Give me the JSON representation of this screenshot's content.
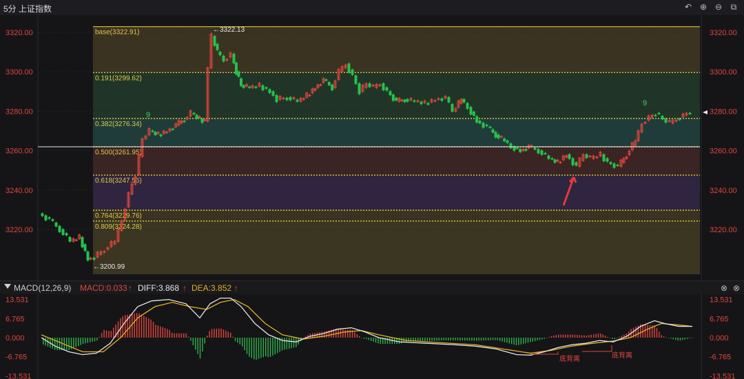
{
  "header": {
    "title": "5分 上证指数"
  },
  "toolbar": {
    "icons": [
      "undo-icon",
      "zoom-in-icon",
      "zoom-out-icon",
      "fullscreen-icon"
    ]
  },
  "price_axis": {
    "labels": [
      "3320.00",
      "3300.00",
      "3280.00",
      "3260.00",
      "3240.00",
      "3220.00"
    ],
    "values": [
      3320,
      3300,
      3280,
      3260,
      3240,
      3220
    ]
  },
  "fib_levels": [
    {
      "label": "base(3322.91)",
      "value": 3322.91,
      "color": "#d7c23c"
    },
    {
      "label": "0.191(3299.62)",
      "value": 3299.62,
      "color": "#d7c23c"
    },
    {
      "label": "0.382(3276.34)",
      "value": 3276.34,
      "color": "#d7c23c"
    },
    {
      "label": "0.500(3261.95)",
      "value": 3261.95,
      "color": "#d7c23c"
    },
    {
      "label": "0.618(3247.56)",
      "value": 3247.56,
      "color": "#d7c23c"
    },
    {
      "label": "0.764(3229.76)",
      "value": 3229.76,
      "color": "#d7c23c"
    },
    {
      "label": "0.809(3224.28)",
      "value": 3224.28,
      "color": "#d7c23c"
    }
  ],
  "annotations": {
    "high": "←3322.13",
    "low": "←3200.99",
    "nine": "9"
  },
  "macd": {
    "indicator": "MACD(12,26,9)",
    "macd_label": "MACD:0.033",
    "diff_label": "DIFF:3.868",
    "dea_label": "DEA:3.852",
    "axis_labels": [
      "13.531",
      "6.765",
      "0.000",
      "-6.765",
      "-13.531"
    ],
    "axis_values": [
      13.531,
      6.765,
      0,
      -6.765,
      -13.531
    ],
    "divergence": "底背离",
    "colors": {
      "up": "#e0463d",
      "down": "#2fb24a",
      "diff": "#e8e8e8",
      "dea": "#e5b21f"
    }
  },
  "colors": {
    "up": "#e0463d",
    "down": "#24c24a",
    "axis_text": "#e0463d",
    "grid": "#2a2a2e"
  }
}
